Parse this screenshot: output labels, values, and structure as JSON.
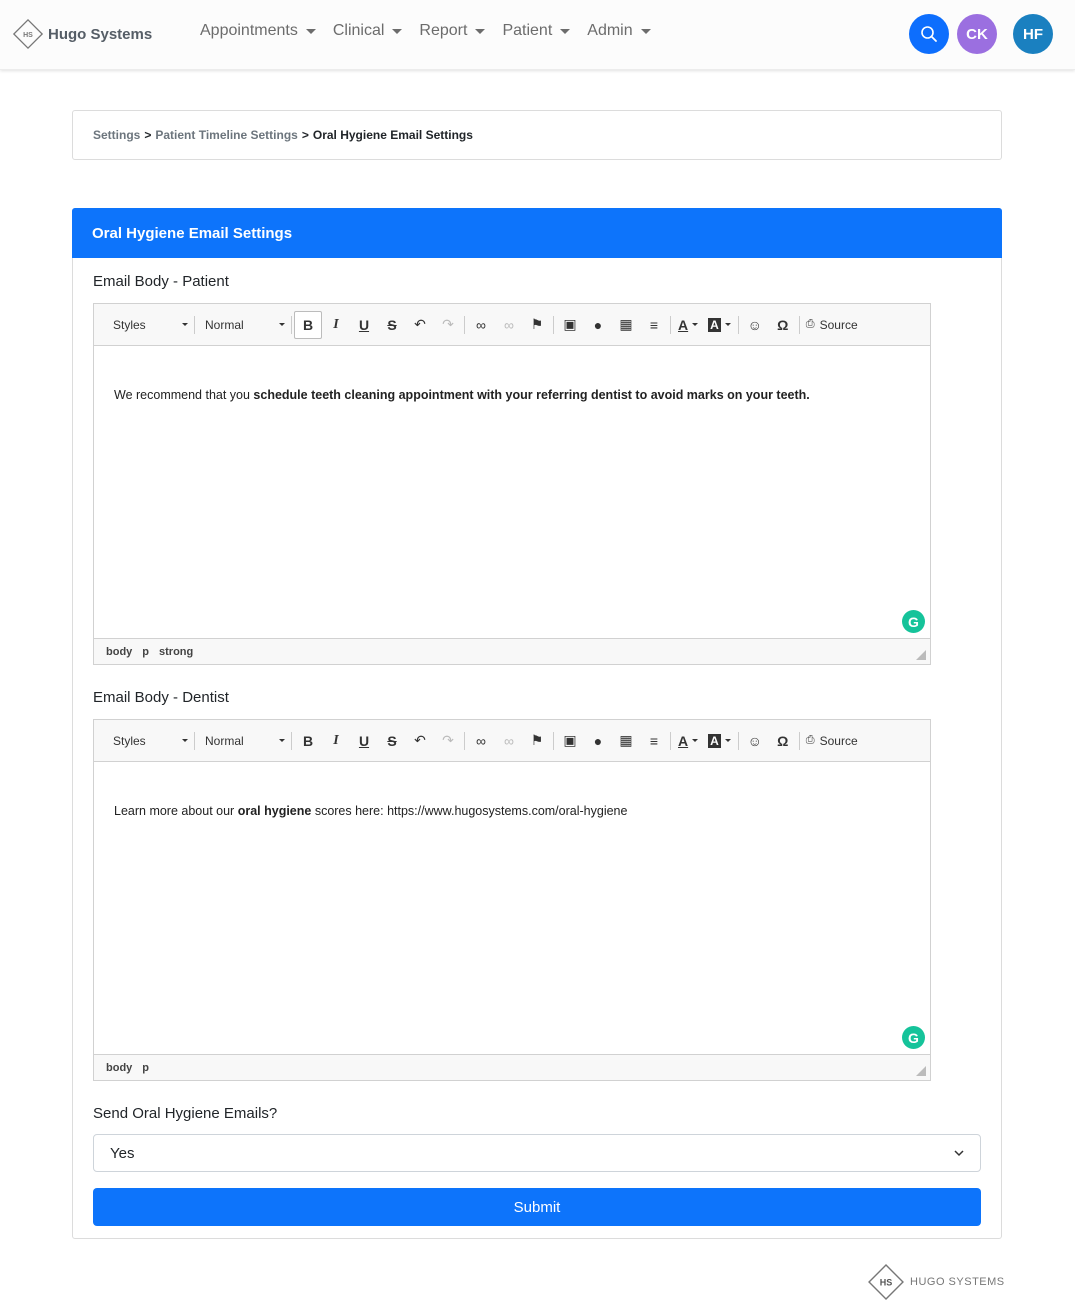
{
  "navbar": {
    "brand_name": "Hugo Systems",
    "brand_logo_text": "HS",
    "menu": [
      {
        "label": "Appointments"
      },
      {
        "label": "Clinical"
      },
      {
        "label": "Report"
      },
      {
        "label": "Patient"
      },
      {
        "label": "Admin"
      }
    ],
    "avatars": [
      {
        "initials": "CK",
        "color": "#9b6fe0"
      },
      {
        "initials": "HF",
        "color": "#1a80c0"
      }
    ]
  },
  "breadcrumb": {
    "items": [
      "Settings",
      "Patient Timeline Settings"
    ],
    "separator": ">",
    "current": "Oral Hygiene Email Settings"
  },
  "card": {
    "title": "Oral Hygiene Email Settings",
    "accent_color": "#0d74fb"
  },
  "editor_toolbar": {
    "styles_label": "Styles",
    "format_label": "Normal",
    "source_label": "Source"
  },
  "patient_editor": {
    "label": "Email Body - Patient",
    "content_plain": "We recommend that you ",
    "content_bold": "schedule teeth cleaning appointment with your referring dentist to avoid marks on your teeth.",
    "path": [
      "body",
      "p",
      "strong"
    ]
  },
  "dentist_editor": {
    "label": "Email Body - Dentist",
    "content_plain_1": "Learn more about our ",
    "content_bold": "oral hygiene",
    "content_plain_2": " scores here: https://www.hugosystems.com/oral-hygiene",
    "path": [
      "body",
      "p"
    ]
  },
  "send_emails": {
    "label": "Send Oral Hygiene Emails?",
    "selected": "Yes"
  },
  "submit_label": "Submit",
  "footer": {
    "logo_text": "HS",
    "brand": "HUGO SYSTEMS"
  }
}
